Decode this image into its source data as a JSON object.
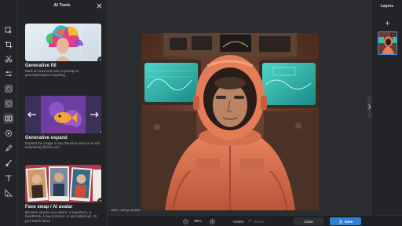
{
  "panel": {
    "title": "AI Tools",
    "cards": [
      {
        "title": "Generative fill",
        "desc": "Mark an area and write a prompt to generate/replace anything."
      },
      {
        "title": "Generative expand",
        "desc": "Expand the image in any direction and our AI will seamlessly fill the void."
      },
      {
        "title": "Face swap / AI avatar",
        "desc": "Become anyone you desire: a superhero, a heartthrob, a law enforcer, or an intellectual. Or just switch faces"
      }
    ]
  },
  "canvas": {
    "size_label": "1024 × 1024 px @ 46%"
  },
  "layers": {
    "title": "Layers",
    "more": "•••"
  },
  "bottombar": {
    "zoom": "68%",
    "undo": "UNDO",
    "redo": "REDO",
    "close": "Close",
    "save": "Save"
  },
  "colors": {
    "accent": "#2f7ed8",
    "panel_bg": "#232427",
    "canvas_bg": "#2b2c2f"
  },
  "icons": [
    "select-icon",
    "crop-icon",
    "cut-icon",
    "adjust-icon",
    "effects-icon",
    "filter-icon",
    "retouch-icon",
    "ai-tools-icon",
    "face-icon",
    "paint-icon",
    "brush-icon",
    "text-icon",
    "graphics-icon"
  ]
}
